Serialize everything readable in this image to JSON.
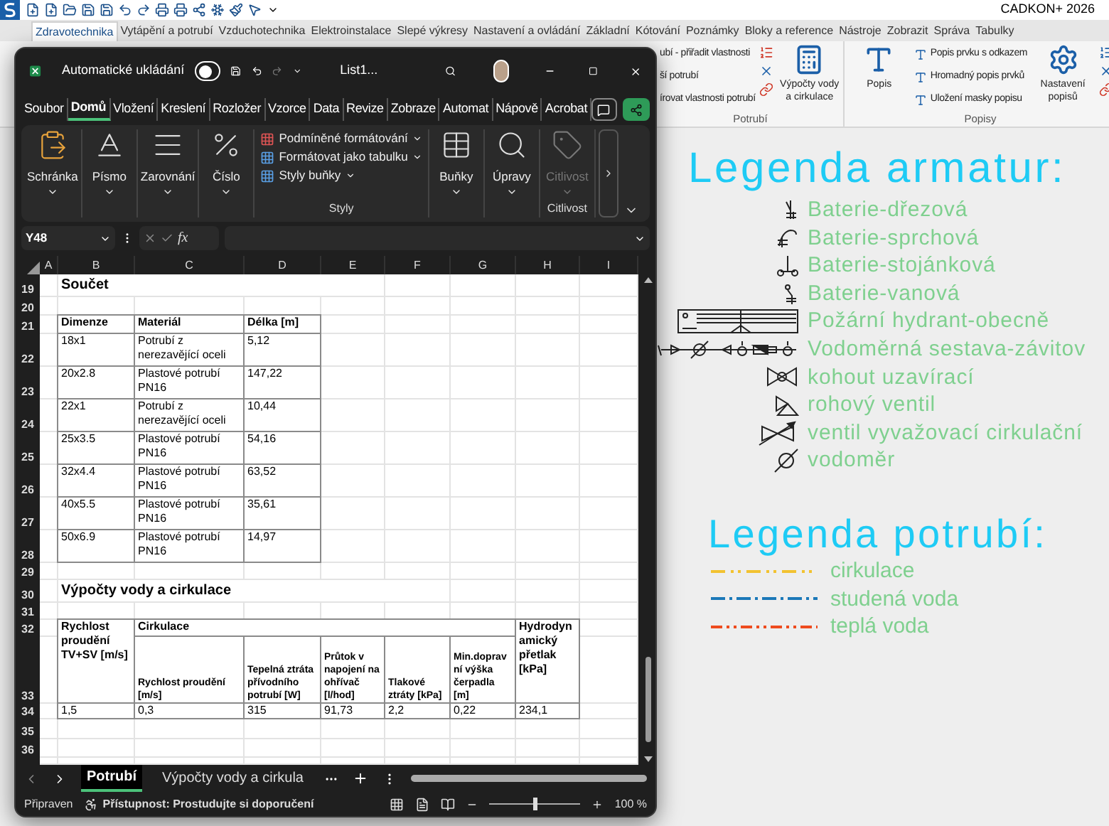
{
  "cad": {
    "app_title": "CADKON+ 2026",
    "tabs": [
      {
        "label": "Zdravotechnika",
        "selected": true
      },
      {
        "label": "Vytápění a potrubí",
        "selected": false
      },
      {
        "label": "Vzduchotechnika",
        "selected": false
      },
      {
        "label": "Elektroinstalace",
        "selected": false
      },
      {
        "label": "Slepé výkresy",
        "selected": false
      },
      {
        "label": "Nastavení a ovládání",
        "selected": false
      },
      {
        "label": "Základní",
        "selected": false
      },
      {
        "label": "Kótování",
        "selected": false
      },
      {
        "label": "Poznámky",
        "selected": false
      },
      {
        "label": "Bloky a reference",
        "selected": false
      },
      {
        "label": "Nástroje",
        "selected": false
      },
      {
        "label": "Zobrazit",
        "selected": false
      },
      {
        "label": "Správa",
        "selected": false
      },
      {
        "label": "Tabulky",
        "selected": false
      }
    ],
    "ribbon": [
      {
        "label": "Potrubí",
        "columns": [
          {
            "kind": "stack",
            "items": [
              "ubí - přiřadit vlastnosti",
              "ší potrubí",
              "írovat vlastnosti potrubí"
            ]
          },
          {
            "kind": "icons"
          },
          {
            "kind": "large",
            "label": "Výpočty vody a cirkulace"
          }
        ]
      },
      {
        "label": "Popisy",
        "columns": [
          {
            "kind": "large",
            "label": "Popis"
          },
          {
            "kind": "stack",
            "items": [
              "Popis prvku s odkazem",
              "Hromadný popis prvků",
              "Uložení masky popisu"
            ]
          },
          {
            "kind": "large",
            "label": "Nastavení popisů"
          },
          {
            "kind": "icons"
          }
        ]
      }
    ]
  },
  "drawing": {
    "fittings_title": "Legenda armatur:",
    "fittings": [
      "Baterie-dřezová",
      "Baterie-sprchová",
      "Baterie-stojánková",
      "Baterie-vanová",
      "Požární hydrant-obecně",
      "Vodoměrná sestava-závitov",
      "kohout uzavírací",
      "rohový ventil",
      "ventil vyvažovací cirkulační",
      "vodoměr"
    ],
    "pipes_title": "Legenda potrubí:",
    "pipes": [
      {
        "label": "cirkulace",
        "color": "#f2c230"
      },
      {
        "label": "studená voda",
        "color": "#1b78b8"
      },
      {
        "label": "teplá voda",
        "color": "#ee4b1e"
      }
    ]
  },
  "excel": {
    "autosave": {
      "label": "Automatické ukládání",
      "on": false
    },
    "file_name": "List1...",
    "menu": [
      {
        "label": "Soubor",
        "selected": false
      },
      {
        "label": "Domů",
        "selected": true
      },
      {
        "label": "Vložení",
        "selected": false
      },
      {
        "label": "Kreslení",
        "selected": false
      },
      {
        "label": "Rozložer",
        "selected": false
      },
      {
        "label": "Vzorce",
        "selected": false
      },
      {
        "label": "Data",
        "selected": false
      },
      {
        "label": "Revize",
        "selected": false
      },
      {
        "label": "Zobraze",
        "selected": false
      },
      {
        "label": "Automat",
        "selected": false
      },
      {
        "label": "Nápově",
        "selected": false
      },
      {
        "label": "Acrobat",
        "selected": false
      }
    ],
    "ribbon": [
      {
        "kind": "button",
        "label": "Schránka",
        "disabled": false
      },
      {
        "kind": "button",
        "label": "Písmo",
        "disabled": false
      },
      {
        "kind": "button",
        "label": "Zarovnání",
        "disabled": false
      },
      {
        "kind": "button",
        "label": "Číslo",
        "disabled": false
      },
      {
        "kind": "list",
        "items": [
          "Podmíněné formátování",
          "Formátovat jako tabulku",
          "Styly buňky"
        ],
        "group_label": "Styly"
      },
      {
        "kind": "button",
        "label": "Buňky",
        "disabled": false
      },
      {
        "kind": "button",
        "label": "Úpravy",
        "disabled": false
      },
      {
        "kind": "button",
        "label": "Citlivost",
        "disabled": true,
        "group_label": "Citlivost"
      }
    ],
    "name_box": "Y48",
    "formula_button": "fx",
    "columns": [
      "A",
      "B",
      "C",
      "D",
      "E",
      "F",
      "G",
      "H",
      "I"
    ],
    "rows": [
      "19",
      "20",
      "21",
      "22",
      "23",
      "24",
      "25",
      "26",
      "27",
      "28",
      "29",
      "30",
      "31",
      "32",
      "33",
      "34",
      "35",
      "36"
    ],
    "sum_title": "Součet",
    "lengths_table": {
      "columns": [
        "Dimenze",
        "Materiál",
        "Délka [m]"
      ],
      "rows": [
        [
          "18x1",
          "Potrubí z nerezavějící oceli",
          "5,12"
        ],
        [
          "20x2.8",
          "Plastové potrubí PN16",
          "147,22"
        ],
        [
          "22x1",
          "Potrubí z nerezavějící oceli",
          "10,44"
        ],
        [
          "25x3.5",
          "Plastové potrubí PN16",
          "54,16"
        ],
        [
          "32x4.4",
          "Plastové potrubí PN16",
          "63,52"
        ],
        [
          "40x5.5",
          "Plastové potrubí PN16",
          "35,61"
        ],
        [
          "50x6.9",
          "Plastové potrubí PN16",
          "14,97"
        ]
      ]
    },
    "calc_title": "Výpočty vody a cirkulace",
    "calc_table": {
      "velocity_header": "Rychlost proudění TV+SV [m/s]",
      "group_header": "Cirkulace",
      "subheaders": [
        "Rychlost proudění [m/s]",
        "Tepelná ztráta přívodního potrubí [W]",
        "Průtok v napojení na ohřívač [l/hod]",
        "Tlakové ztráty [kPa]",
        "Min.dopravní výška čerpadla [m]"
      ],
      "pressure_header": "Hydrodynamický přetlak [kPa]",
      "values": [
        "1,5",
        "0,3",
        "315",
        "91,73",
        "2,2",
        "0,22",
        "234,1"
      ]
    },
    "sheet_tabs": [
      {
        "label": "Potrubí",
        "selected": true
      },
      {
        "label": "Výpočty vody a cirkula",
        "selected": false
      }
    ],
    "status": "Připraven",
    "accessibility": "Přístupnost: Prostudujte si doporučení",
    "zoom": {
      "level": 0.5,
      "reading": "100 %"
    }
  }
}
